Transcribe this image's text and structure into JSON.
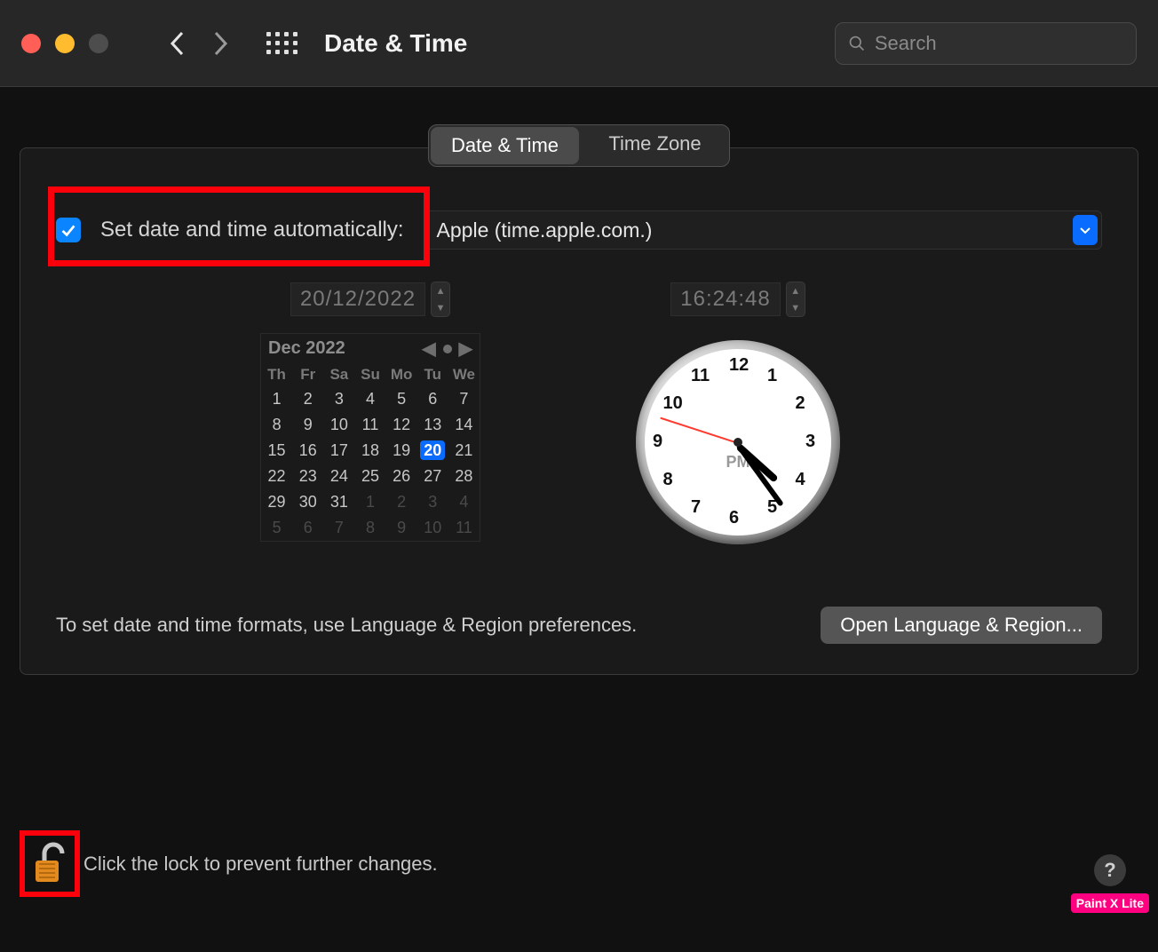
{
  "window": {
    "title": "Date & Time"
  },
  "search": {
    "placeholder": "Search"
  },
  "tabs": {
    "date_time": "Date & Time",
    "time_zone": "Time Zone"
  },
  "auto": {
    "checked": true,
    "label": "Set date and time automatically:",
    "server": "Apple (time.apple.com.)"
  },
  "date": "20/12/2022",
  "time": "16:24:48",
  "clock": {
    "ampm": "PM",
    "hour": 4,
    "minute": 24,
    "second": 48
  },
  "calendar": {
    "month_label": "Dec 2022",
    "day_headers": [
      "Th",
      "Fr",
      "Sa",
      "Su",
      "Mo",
      "Tu",
      "We"
    ],
    "days": [
      {
        "n": 1
      },
      {
        "n": 2
      },
      {
        "n": 3
      },
      {
        "n": 4
      },
      {
        "n": 5
      },
      {
        "n": 6
      },
      {
        "n": 7
      },
      {
        "n": 8
      },
      {
        "n": 9
      },
      {
        "n": 10
      },
      {
        "n": 11
      },
      {
        "n": 12
      },
      {
        "n": 13
      },
      {
        "n": 14
      },
      {
        "n": 15
      },
      {
        "n": 16
      },
      {
        "n": 17
      },
      {
        "n": 18
      },
      {
        "n": 19
      },
      {
        "n": 20,
        "sel": true
      },
      {
        "n": 21
      },
      {
        "n": 22
      },
      {
        "n": 23
      },
      {
        "n": 24
      },
      {
        "n": 25
      },
      {
        "n": 26
      },
      {
        "n": 27
      },
      {
        "n": 28
      },
      {
        "n": 29
      },
      {
        "n": 30
      },
      {
        "n": 31
      },
      {
        "n": 1,
        "out": true
      },
      {
        "n": 2,
        "out": true
      },
      {
        "n": 3,
        "out": true
      },
      {
        "n": 4,
        "out": true
      },
      {
        "n": 5,
        "out": true
      },
      {
        "n": 6,
        "out": true
      },
      {
        "n": 7,
        "out": true
      },
      {
        "n": 8,
        "out": true
      },
      {
        "n": 9,
        "out": true
      },
      {
        "n": 10,
        "out": true
      },
      {
        "n": 11,
        "out": true
      }
    ]
  },
  "footer": {
    "text": "To set date and time formats, use Language & Region preferences.",
    "button": "Open Language & Region..."
  },
  "lock": {
    "text": "Click the lock to prevent further changes."
  },
  "help_label": "?",
  "badge": "Paint X Lite",
  "clock_numbers": [
    "12",
    "1",
    "2",
    "3",
    "4",
    "5",
    "6",
    "7",
    "8",
    "9",
    "10",
    "11"
  ]
}
